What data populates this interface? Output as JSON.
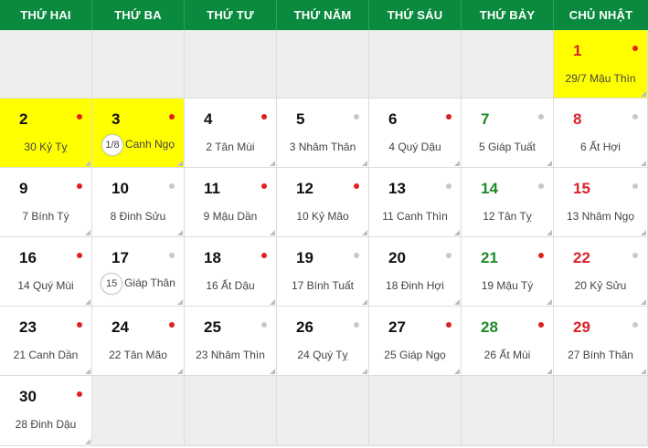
{
  "weekdays": [
    "THỨ HAI",
    "THỨ BA",
    "THỨ TƯ",
    "THỨ NĂM",
    "THỨ SÁU",
    "THỨ BẢY",
    "CHỦ NHẬT"
  ],
  "colors": {
    "header_bg": "#0a8a3e",
    "highlight": "#ffff00",
    "saturday": "#1f8a2a",
    "sunday": "#d9232a",
    "dot_red": "#e02020",
    "dot_gray": "#c8c8c8"
  },
  "days": [
    {
      "day": "1",
      "lunar": "29/7 Mậu Thìn",
      "dot": "red",
      "highlight": true
    },
    {
      "day": "2",
      "lunar": "30 Kỷ Tỵ",
      "dot": "red",
      "highlight": true
    },
    {
      "day": "3",
      "badge": "1/8",
      "lunar": "Canh Ngọ",
      "dot": "red",
      "highlight": true
    },
    {
      "day": "4",
      "lunar": "2 Tân Mùi",
      "dot": "red"
    },
    {
      "day": "5",
      "lunar": "3 Nhâm Thân",
      "dot": "gray"
    },
    {
      "day": "6",
      "lunar": "4 Quý Dậu",
      "dot": "red"
    },
    {
      "day": "7",
      "lunar": "5 Giáp Tuất",
      "dot": "gray"
    },
    {
      "day": "8",
      "lunar": "6 Ất Hợi",
      "dot": "gray"
    },
    {
      "day": "9",
      "lunar": "7 Bính Tý",
      "dot": "red"
    },
    {
      "day": "10",
      "lunar": "8 Đinh Sửu",
      "dot": "gray"
    },
    {
      "day": "11",
      "lunar": "9 Mậu Dần",
      "dot": "red"
    },
    {
      "day": "12",
      "lunar": "10 Kỷ Mão",
      "dot": "red"
    },
    {
      "day": "13",
      "lunar": "11 Canh Thìn",
      "dot": "gray"
    },
    {
      "day": "14",
      "lunar": "12 Tân Tỵ",
      "dot": "gray"
    },
    {
      "day": "15",
      "lunar": "13 Nhâm Ngọ",
      "dot": "gray"
    },
    {
      "day": "16",
      "lunar": "14 Quý Mùi",
      "dot": "red"
    },
    {
      "day": "17",
      "badge": "15",
      "lunar": "Giáp Thân",
      "dot": "gray"
    },
    {
      "day": "18",
      "lunar": "16 Ất Dậu",
      "dot": "red"
    },
    {
      "day": "19",
      "lunar": "17 Bính Tuất",
      "dot": "gray"
    },
    {
      "day": "20",
      "lunar": "18 Đinh Hợi",
      "dot": "gray"
    },
    {
      "day": "21",
      "lunar": "19 Mậu Tý",
      "dot": "red"
    },
    {
      "day": "22",
      "lunar": "20 Kỷ Sửu",
      "dot": "gray"
    },
    {
      "day": "23",
      "lunar": "21 Canh Dần",
      "dot": "red"
    },
    {
      "day": "24",
      "lunar": "22 Tân Mão",
      "dot": "red"
    },
    {
      "day": "25",
      "lunar": "23 Nhâm Thìn",
      "dot": "gray"
    },
    {
      "day": "26",
      "lunar": "24 Quý Tỵ",
      "dot": "gray"
    },
    {
      "day": "27",
      "lunar": "25 Giáp Ngọ",
      "dot": "red"
    },
    {
      "day": "28",
      "lunar": "26 Ất Mùi",
      "dot": "red"
    },
    {
      "day": "29",
      "lunar": "27 Bính Thân",
      "dot": "gray"
    },
    {
      "day": "30",
      "lunar": "28 Đinh Dậu",
      "dot": "red"
    }
  ]
}
